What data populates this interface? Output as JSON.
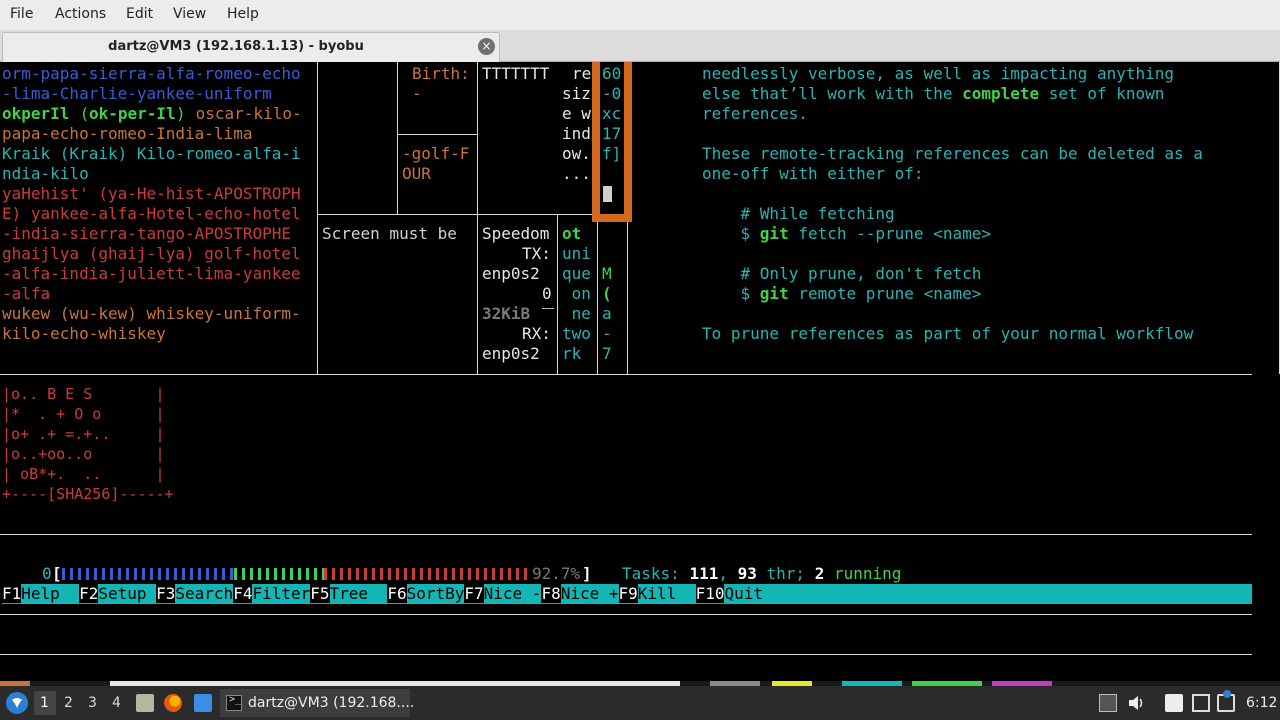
{
  "menubar": {
    "items": [
      "File",
      "Actions",
      "Edit",
      "View",
      "Help"
    ]
  },
  "tab": {
    "title": "dartz@VM3 (192.168.1.13) - byobu",
    "close_symbol": "×"
  },
  "terminal": {
    "pane_a": {
      "lines": [
        "orm-papa-sierra-alfa-romeo-echo",
        "-lima-Charlie-yankee-uniform",
        "okperIl",
        " (",
        "ok-per-Il",
        ")",
        " oscar-kilo-",
        "papa-echo-romeo-India-lima",
        "Kraik (Kraik) Kilo-romeo-alfa-i",
        "ndia-kilo",
        "yaHehist' (ya-He-hist-APOSTROPH",
        "E) yankee-alfa-Hotel-echo-hotel",
        "-india-sierra-tango-APOSTROPHE",
        "ghaijlya (ghaij-lya) golf-hotel",
        "-alfa-india-juliett-lima-yankee",
        "-alfa",
        "wukew (wu-kew) whiskey-uniform-",
        "kilo-echo-whiskey"
      ]
    },
    "pane_b": {
      "birth_label": "Birth:",
      "birth_dash": "-",
      "golf_line1": "-golf-F",
      "golf_line2": "OUR",
      "screen_text": "Screen must be"
    },
    "pane_c": {
      "top_text": "TTTTTTT",
      "speedom": "Speedom",
      "tx": "TX:",
      "iface1": "enp0s2",
      "zero": "0",
      "kib": "32KiB",
      "rx": "RX:",
      "iface2": "enp0s2"
    },
    "pane_d": {
      "lines": [
        "re",
        "siz",
        "e w",
        "ind",
        "ow.",
        "..."
      ],
      "lower": [
        "ot",
        "uni",
        "que",
        " on",
        " ne",
        "two",
        "rk"
      ]
    },
    "pane_e": {
      "orange_lines": [
        "60",
        "-0",
        "xc",
        "17",
        "f]"
      ],
      "lower": [
        "M",
        "(",
        "a",
        "-",
        "7"
      ]
    },
    "pane_git": {
      "line1": "needlessly verbose, as well as impacting anything",
      "line2a": "else that’ll work with the ",
      "line2b": "complete",
      "line2c": " set of known",
      "line3": "references.",
      "line4": "These remote-tracking references can be deleted as a",
      "line5": "one-off with either of:",
      "line6": "    # While fetching",
      "line7a": "    $ ",
      "line7b": "git",
      "line7c": " fetch --prune <name>",
      "line8": "    # Only prune, don't fetch",
      "line9a": "    $ ",
      "line9b": "git",
      "line9c": " remote prune <name>",
      "line10": "To prune references as part of your normal workflow"
    },
    "randomart": [
      "|o.. B E S       |",
      "|*  . + O o      |",
      "|o+ .+ =.+..     |",
      "|o..+oo..o       |",
      "| oB*+.  ..      |",
      "+----[SHA256]-----+"
    ],
    "htop": {
      "cpu_label": "0",
      "cpu_percent": "92.7%",
      "tasks_label": "Tasks:",
      "tasks_count": "111",
      "threads": "93",
      "thr_label": "thr;",
      "running_count": "2",
      "running_label": "running",
      "fkeys": [
        {
          "key": "F1",
          "label": "Help  "
        },
        {
          "key": "F2",
          "label": "Setup "
        },
        {
          "key": "F3",
          "label": "Search"
        },
        {
          "key": "F4",
          "label": "Filter"
        },
        {
          "key": "F5",
          "label": "Tree  "
        },
        {
          "key": "F6",
          "label": "SortBy"
        },
        {
          "key": "F7",
          "label": "Nice -"
        },
        {
          "key": "F8",
          "label": "Nice +"
        },
        {
          "key": "F9",
          "label": "Kill  "
        },
        {
          "key": "F10",
          "label": "Quit"
        }
      ]
    }
  },
  "taskbar": {
    "workspaces": [
      "1",
      "2",
      "3",
      "4"
    ],
    "window_title": "dartz@VM3 (192.168....",
    "clock": "6:12",
    "icons": [
      "start-icon",
      "files-icon",
      "firefox-icon",
      "folder-icon",
      "terminal-icon",
      "eject-icon",
      "volume-icon",
      "clipboard-icon",
      "display-icon",
      "network-icon"
    ]
  },
  "colors": {
    "blue": "#3b5bd6",
    "green": "#3fd24a",
    "red": "#c83c3c",
    "orange": "#c8743a",
    "cyan": "#2ab3b3",
    "teal_bar": "#13b5b5",
    "orange_bar": "#d2691e"
  }
}
